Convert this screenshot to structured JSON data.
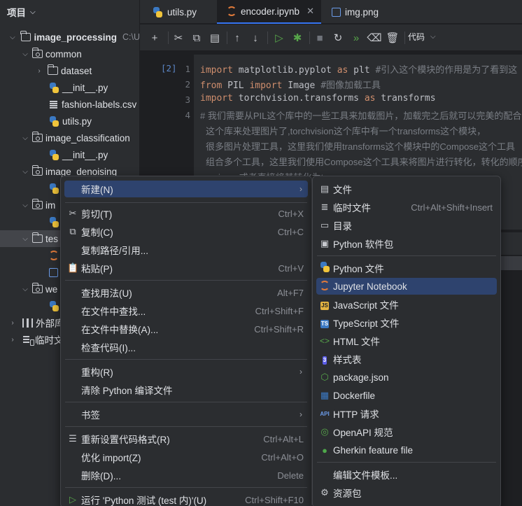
{
  "project_panel": {
    "title": "项目",
    "tree": [
      {
        "name": "image_processing",
        "path": "C:\\U",
        "bold": true
      },
      {
        "name": "common"
      },
      {
        "name": "dataset"
      },
      {
        "name": "__init__.py"
      },
      {
        "name": "fashion-labels.csv"
      },
      {
        "name": "utils.py"
      },
      {
        "name": "image_classification"
      },
      {
        "name": "__init__.py"
      },
      {
        "name": "image_denoising"
      },
      {
        "name": "im"
      },
      {
        "name": "tes"
      },
      {
        "name": "we"
      },
      {
        "name": "外部库"
      },
      {
        "name": "临时文"
      }
    ]
  },
  "tabs": [
    {
      "label": "utils.py"
    },
    {
      "label": "encoder.ipynb"
    },
    {
      "label": "img.png"
    }
  ],
  "toolbar": {
    "code_label": "代码"
  },
  "editor": {
    "exec_label": "[2]",
    "lines": [
      {
        "num": "1",
        "prefix": "import ",
        "mid": "matplotlib.pyplot ",
        "kw2": "as ",
        "rest": "plt ",
        "comment": "#引入这个模块的作用是为了看到这"
      },
      {
        "num": "2",
        "prefix": "from ",
        "mid": "PIL ",
        "kw2": "import ",
        "rest": "Image ",
        "comment": "#图像加载工具"
      },
      {
        "num": "3",
        "prefix": "import ",
        "mid": "torchvision.transforms ",
        "kw2": "as ",
        "rest": "transforms",
        "comment": ""
      },
      {
        "num": "4",
        "prefix": "",
        "mid": "",
        "kw2": "",
        "rest": "",
        "comment": "# 我们需要从PIL这个库中的一些工具来加载图片，加载完之后就可以完美的配合"
      }
    ],
    "comment_continuation": [
      "这个库来处理图片了,torchvision这个库中有一个transforms这个模块，",
      "很多图片处理工具，这里我们使用transforms这个模块中的Compose这个工具",
      "组合多个工具，这里我们使用Compose这个工具来将图片进行转化，转化的顺序",
      "resize，或者直接将其转化为tensor"
    ]
  },
  "context_menu": {
    "items": [
      {
        "label": "新建(N)",
        "key": "",
        "submenu": true,
        "icon": ""
      },
      {
        "label": "剪切(T)",
        "key": "Ctrl+X",
        "icon": "✂"
      },
      {
        "label": "复制(C)",
        "key": "Ctrl+C",
        "icon": "⧉"
      },
      {
        "label": "复制路径/引用...",
        "key": "",
        "icon": ""
      },
      {
        "label": "粘贴(P)",
        "key": "Ctrl+V",
        "icon": "📋"
      },
      {
        "label": "查找用法(U)",
        "key": "Alt+F7",
        "icon": ""
      },
      {
        "label": "在文件中查找...",
        "key": "Ctrl+Shift+F",
        "icon": ""
      },
      {
        "label": "在文件中替换(A)...",
        "key": "Ctrl+Shift+R",
        "icon": ""
      },
      {
        "label": "检查代码(I)...",
        "key": "",
        "icon": ""
      },
      {
        "label": "重构(R)",
        "key": "",
        "submenu": true,
        "icon": ""
      },
      {
        "label": "清除 Python 编译文件",
        "key": "",
        "icon": ""
      },
      {
        "label": "书签",
        "key": "",
        "submenu": true,
        "icon": ""
      },
      {
        "label": "重新设置代码格式(R)",
        "key": "Ctrl+Alt+L",
        "icon": "☰"
      },
      {
        "label": "优化 import(Z)",
        "key": "Ctrl+Alt+O",
        "icon": ""
      },
      {
        "label": "删除(D)...",
        "key": "Delete",
        "icon": ""
      },
      {
        "label": "运行 'Python 测试 (test 内)'(U)",
        "key": "Ctrl+Shift+F10",
        "icon": "▷"
      }
    ]
  },
  "new_submenu": {
    "items": [
      {
        "label": "文件",
        "key": "",
        "icon": "file-icon"
      },
      {
        "label": "临时文件",
        "key": "Ctrl+Alt+Shift+Insert",
        "icon": "scratch-file-icon"
      },
      {
        "label": "目录",
        "key": "",
        "icon": "folder-icon"
      },
      {
        "label": "Python 软件包",
        "key": "",
        "icon": "package-icon"
      },
      {
        "label": "Python 文件",
        "key": "",
        "icon": "python-icon"
      },
      {
        "label": "Jupyter Notebook",
        "key": "",
        "icon": "jupyter-icon"
      },
      {
        "label": "JavaScript 文件",
        "key": "",
        "icon": "js-icon"
      },
      {
        "label": "TypeScript 文件",
        "key": "",
        "icon": "ts-icon"
      },
      {
        "label": "HTML 文件",
        "key": "",
        "icon": "html-icon"
      },
      {
        "label": "样式表",
        "key": "",
        "icon": "css-icon"
      },
      {
        "label": "package.json",
        "key": "",
        "icon": "nodejs-icon"
      },
      {
        "label": "Dockerfile",
        "key": "",
        "icon": "docker-icon"
      },
      {
        "label": "HTTP 请求",
        "key": "",
        "icon": "api-icon"
      },
      {
        "label": "OpenAPI 规范",
        "key": "",
        "icon": "openapi-icon"
      },
      {
        "label": "Gherkin feature file",
        "key": "",
        "icon": "gherkin-icon"
      },
      {
        "label": "编辑文件模板...",
        "key": "",
        "icon": ""
      },
      {
        "label": "资源包",
        "key": "",
        "icon": "gear-icon"
      }
    ],
    "icon_texts": {
      "js": "JS",
      "ts": "TS",
      "api": "API",
      "html": "<>",
      "css": "3"
    },
    "colors": {
      "highlight": "#2e436e",
      "js": "#e3b341",
      "ts": "#3b79c3",
      "docker": "#3b79c3",
      "gherkin": "#4ea84a"
    }
  }
}
